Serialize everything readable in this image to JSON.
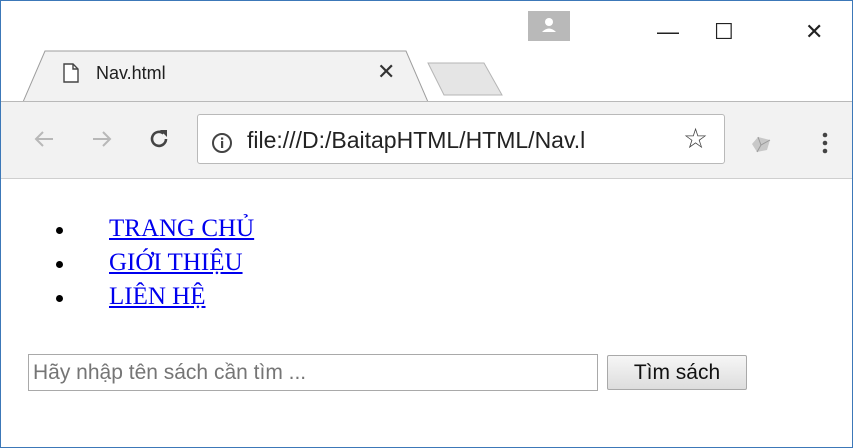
{
  "tab": {
    "title": "Nav.html",
    "icon": "page-icon"
  },
  "window_controls": {
    "minimize": "—",
    "maximize": "☐",
    "close": "✕"
  },
  "toolbar": {
    "url": "file:///D:/BaitapHTML/HTML/Nav.l",
    "info_icon": "info-icon",
    "star": "☆"
  },
  "nav": {
    "items": [
      {
        "label": "TRANG CHỦ"
      },
      {
        "label": "GIỚI THIỆU"
      },
      {
        "label": "LIÊN HỆ"
      }
    ]
  },
  "search": {
    "placeholder": "Hãy nhập tên sách cần tìm ...",
    "value": "",
    "button_label": "Tìm sách"
  }
}
